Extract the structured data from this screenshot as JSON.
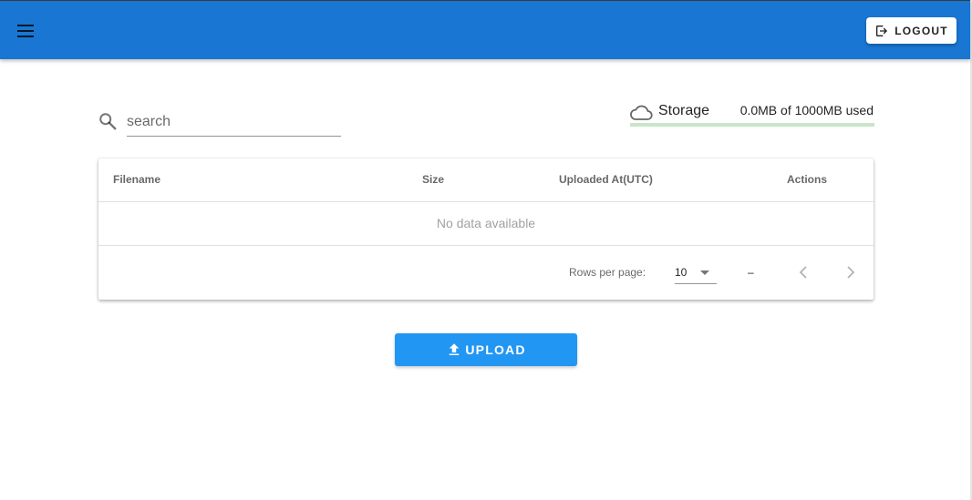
{
  "header": {
    "logout_label": "LOGOUT",
    "icons": {
      "menu": "menu-icon",
      "logout": "logout-icon"
    },
    "colors": {
      "appbar": "#1976d2"
    }
  },
  "search": {
    "placeholder": "search",
    "value": "",
    "icon": "search-icon"
  },
  "storage": {
    "label": "Storage",
    "used_text": "0.0MB of 1000MB used",
    "used_fraction": 0.0,
    "icon": "cloud-icon",
    "colors": {
      "track": "#c8e6c9",
      "fill": "#4caf50"
    }
  },
  "table": {
    "columns": [
      "Filename",
      "Size",
      "Uploaded At(UTC)",
      "Actions"
    ],
    "rows": [],
    "empty_text": "No data available",
    "footer": {
      "rows_per_page_label": "Rows per page:",
      "rows_per_page_value": "10",
      "page_range": "–",
      "icons": {
        "prev": "chevron-left-icon",
        "next": "chevron-right-icon"
      }
    }
  },
  "upload": {
    "label": "UPLOAD",
    "icon": "upload-icon",
    "color": "#2196f3"
  }
}
